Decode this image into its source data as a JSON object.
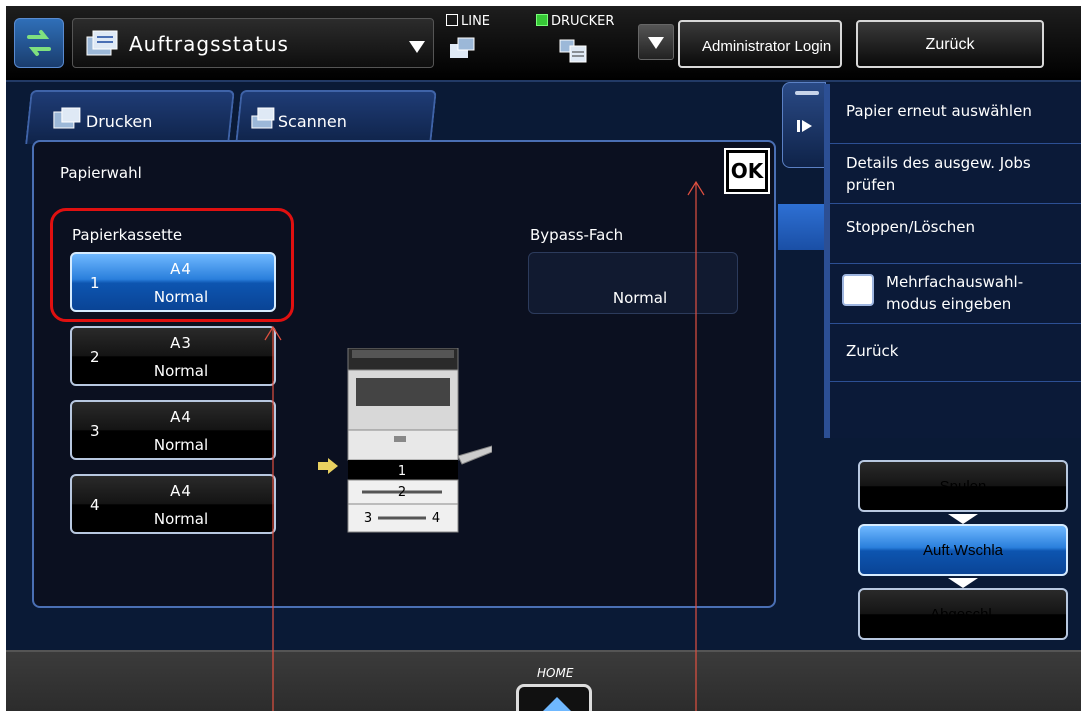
{
  "header": {
    "title": "Auftragsstatus",
    "status_line": "LINE",
    "status_printer": "DRUCKER",
    "admin_login": "Administrator Login",
    "back": "Zurück"
  },
  "tabs": [
    {
      "label": "Drucken"
    },
    {
      "label": "Scannen"
    }
  ],
  "paper": {
    "section_title": "Papierwahl",
    "ok": "OK",
    "cassette_label": "Papierkassette",
    "bypass_label": "Bypass-Fach",
    "bypass_type": "Normal",
    "trays": [
      {
        "num": "1",
        "size": "A4",
        "type": "Normal"
      },
      {
        "num": "2",
        "size": "A3",
        "type": "Normal"
      },
      {
        "num": "3",
        "size": "A4",
        "type": "Normal"
      },
      {
        "num": "4",
        "size": "A4",
        "type": "Normal"
      }
    ],
    "copier_labels": [
      "1",
      "2",
      "3",
      "4"
    ]
  },
  "side_menu": {
    "items": [
      "Papier erneut auswählen",
      "Details des ausgew. Jobs prüfen",
      "Stoppen/Löschen",
      "Mehrfachauswahl-modus eingeben",
      "Zurück"
    ]
  },
  "job_buttons": {
    "spool": "Spulen",
    "queue": "Auft.Wschla",
    "done": "Abgeschl."
  },
  "footer": {
    "home": "HOME"
  },
  "colors": {
    "accent": "#1a63c6",
    "panel": "#0a1a36",
    "highlight": "#e01010"
  }
}
